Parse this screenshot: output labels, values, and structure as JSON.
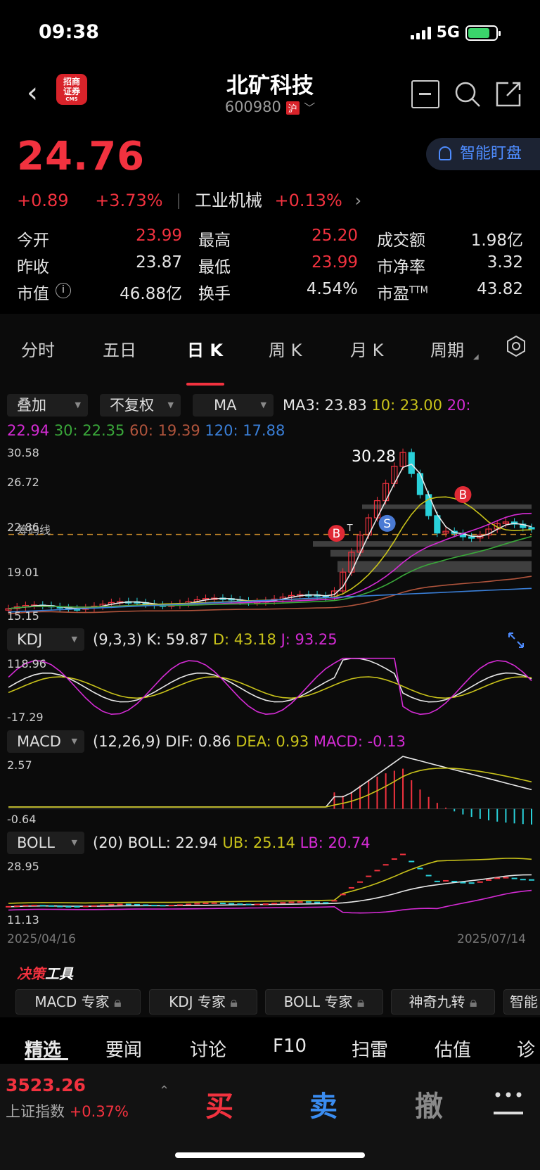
{
  "status": {
    "time": "09:38",
    "network": "5G"
  },
  "header": {
    "title": "北矿科技",
    "code": "600980",
    "exchange": "沪",
    "broker_logo_l1": "招商",
    "broker_logo_l2": "证券",
    "broker_logo_l3": "CMS"
  },
  "quote": {
    "price": "24.76",
    "change": "+0.89",
    "change_pct": "+3.73%",
    "sector": "工业机械",
    "sector_pct": "+0.13%",
    "watch_label": "智能盯盘"
  },
  "stats": {
    "open_label": "今开",
    "open": "23.99",
    "high_label": "最高",
    "high": "25.20",
    "amount_label": "成交额",
    "amount": "1.98亿",
    "prev_label": "昨收",
    "prev": "23.87",
    "low_label": "最低",
    "low": "23.99",
    "pb_label": "市净率",
    "pb": "3.32",
    "mcap_label": "市值",
    "mcap": "46.88亿",
    "turnover_label": "换手",
    "turnover": "4.54%",
    "pe_label": "市盈",
    "pe_sup": "TTM",
    "pe": "43.82"
  },
  "tabs": [
    "分时",
    "五日",
    "日 K",
    "周 K",
    "月 K",
    "周期"
  ],
  "active_tab": "日 K",
  "toolbar": {
    "overlay": "叠加",
    "adjust": "不复权",
    "indicator": "MA"
  },
  "ma": {
    "ma3": "MA3: 23.83",
    "ma10": "10: 23.00",
    "ma20_label": "20:",
    "ma20": "22.94",
    "ma30": "30: 22.35",
    "ma60": "60: 19.39",
    "ma120": "120: 17.88"
  },
  "kline": {
    "yticks": [
      "30.58",
      "26.72",
      "22.86",
      "19.01",
      "15.15"
    ],
    "peak_label": "30.28",
    "cost_line_label": "筹码线",
    "buy_marker": "B",
    "sell_marker": "S",
    "t_marker": "T"
  },
  "kdj": {
    "name": "KDJ",
    "params": "(9,3,3)",
    "k": "K: 59.87",
    "d": "D: 43.18",
    "j": "J: 93.25",
    "ytop": "118.96",
    "ybot": "-17.29"
  },
  "macd": {
    "name": "MACD",
    "params": "(12,26,9)",
    "dif": "DIF: 0.86",
    "dea": "DEA: 0.93",
    "macd": "MACD: -0.13",
    "ytop": "2.57",
    "ybot": "-0.64"
  },
  "boll": {
    "name": "BOLL",
    "params": "(20)",
    "mid": "BOLL: 22.94",
    "ub": "UB: 25.14",
    "lb": "LB: 20.74",
    "ytop": "28.95",
    "ybot": "11.13"
  },
  "dates": {
    "start": "2025/04/16",
    "end": "2025/07/14"
  },
  "tools": {
    "title_a": "决策",
    "title_b": "工具",
    "items": [
      "MACD 专家",
      "KDJ 专家",
      "BOLL 专家",
      "神奇九转",
      "智能"
    ]
  },
  "bottom_tabs": [
    "精选",
    "要闻",
    "讨论",
    "F10",
    "扫雷",
    "估值",
    "诊"
  ],
  "footer": {
    "index_value": "3523.26",
    "index_name": "上证指数",
    "index_pct": "+0.37%",
    "buy": "买",
    "sell": "卖",
    "cancel": "撤"
  },
  "colors": {
    "up": "#f2323f",
    "down": "#29d0d9",
    "ma3": "#e8e8e8",
    "ma10": "#c8c21a",
    "ma20": "#d42bd4",
    "ma30": "#3aa83a",
    "ma60": "#b0543c",
    "ma120": "#3a7fd8"
  }
}
